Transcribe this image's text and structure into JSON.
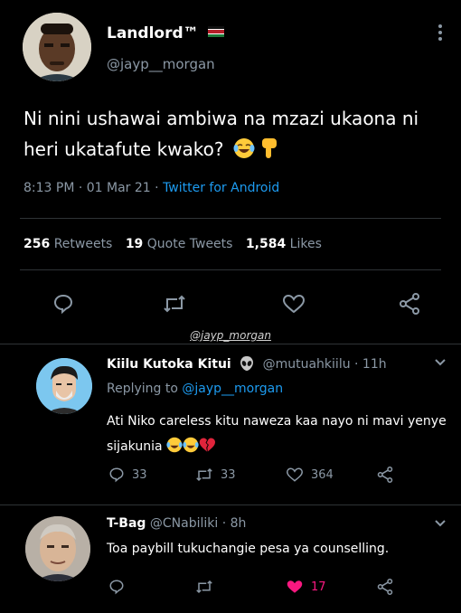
{
  "tweet": {
    "author_name": "Landlord™",
    "author_handle": "@jayp__morgan",
    "text": "Ni nini ushawai ambiwa na mzazi ukaona ni heri ukatafute kwako?",
    "meta_time": "8:13 PM · 01 Mar 21 · ",
    "meta_source": "Twitter for Android",
    "retweets_num": "256",
    "retweets_label": "Retweets",
    "quotes_num": "19",
    "quotes_label": "Quote Tweets",
    "likes_num": "1,584",
    "likes_label": "Likes"
  },
  "watermark": "@jayp_morgan",
  "replies": [
    {
      "name": "Kiilu Kutoka Kitui",
      "handle_time": "@mutuahkiilu · 11h",
      "replying_prefix": "Replying to ",
      "replying_handle": "@jayp__morgan",
      "text": "Ati Niko careless kitu naweza kaa nayo ni mavi yenye sijakunia",
      "replies": "33",
      "retweets": "33",
      "likes": "364"
    },
    {
      "name": "T-Bag",
      "handle_time": "@CNabiliki · 8h",
      "text": "Toa paybill tukuchangie pesa ya counselling.",
      "likes": "17"
    }
  ],
  "colors": {
    "background": "#000000",
    "link": "#1d9bf0",
    "like_active": "#f91880",
    "muted": "#8b98a5"
  }
}
